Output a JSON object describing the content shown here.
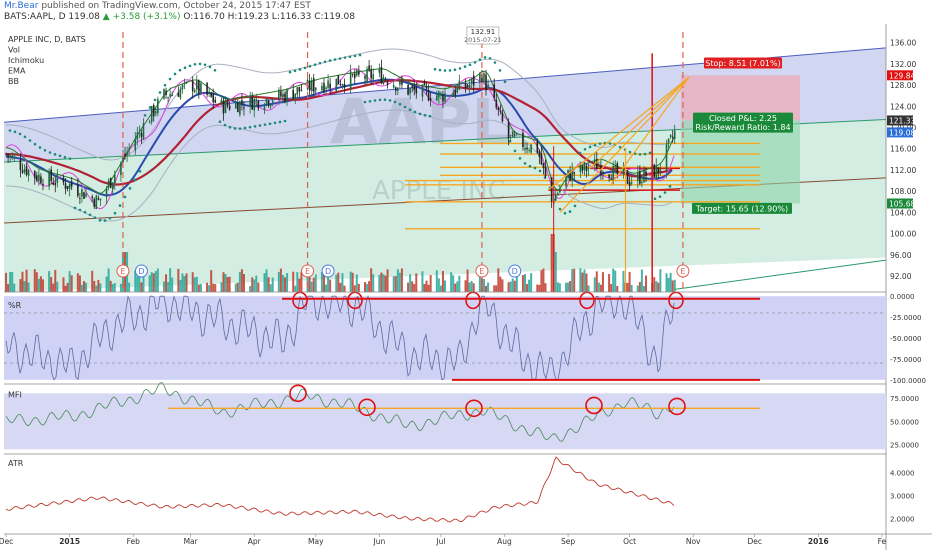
{
  "header": {
    "author": "Mr.Bear",
    "published": "published on TradingView.com, October 24, 2015 17:47 EST",
    "symbol": "BATS:AAPL, D",
    "price": "119.08",
    "change": "+3.58 (+3.1%)",
    "ohlc": "O:116.70 H:119.23 L:116.33 C:119.08"
  },
  "colors": {
    "up": "#26a69a",
    "down": "#c0392b",
    "ema": "#b22234",
    "bb": "#1010aa",
    "ichimoku_conv": "#e040e0",
    "ichimoku_cloud_up": "#c8ead4",
    "ichimoku_cloud_down": "#f7c8cf",
    "annotation": "#e01010",
    "level": "#f5a623",
    "channel": "#4a5cc0"
  },
  "chart_data": [
    {
      "type": "candlestick",
      "pane": "price",
      "legend": [
        "APPLE INC, D, BATS",
        "Vol",
        "Ichimoku",
        "EMA",
        "BB"
      ],
      "watermark": [
        "AAPL",
        "APPLE INC"
      ],
      "x_ticks": [
        "Dec",
        "2015",
        "Feb",
        "Mar",
        "Apr",
        "May",
        "Jun",
        "Jul",
        "Aug",
        "Sep",
        "Oct",
        "Nov",
        "Dec",
        "2016",
        "Fe"
      ],
      "y_ticks": [
        "136.00",
        "132.00",
        "128.00",
        "124.00",
        "120.00",
        "116.00",
        "112.00",
        "108.00",
        "104.00",
        "100.00",
        "96.00",
        "92.00"
      ],
      "ylim": [
        89,
        138
      ],
      "price_labels": [
        {
          "value": 129.84,
          "label": "129.84",
          "color": "#e01010"
        },
        {
          "value": 121.33,
          "label": "121.33",
          "color": "#333333"
        },
        {
          "value": 119.08,
          "label": "119.08",
          "color": "#2a6fd6"
        },
        {
          "value": 105.68,
          "label": "105.68",
          "color": "#1a8a3a"
        }
      ],
      "peak_label": {
        "price": "132.91",
        "date": "2015-07-21"
      },
      "earnings_markers": [
        "E",
        "D",
        "E",
        "D",
        "E",
        "D",
        "E"
      ],
      "position": {
        "stop": "Stop: 8.51 (7.01%)",
        "pnl": "Closed P&L: 2.25",
        "rr": "Risk/Reward Ratio: 1.84",
        "target": "Target: 15.65 (12.90%)",
        "entry": 121.33,
        "stop_price": 129.84,
        "target_price": 105.68
      },
      "horizontal_levels": [
        117.0,
        115.0,
        112.5,
        111.0,
        110.0,
        109.2,
        106.0,
        100.9
      ],
      "series": [
        {
          "name": "Close",
          "x": [
            "2014-12-01",
            "2014-12-15",
            "2015-01-02",
            "2015-01-15",
            "2015-02-02",
            "2015-02-16",
            "2015-03-02",
            "2015-03-16",
            "2015-04-01",
            "2015-04-15",
            "2015-05-01",
            "2015-05-15",
            "2015-06-01",
            "2015-06-15",
            "2015-07-01",
            "2015-07-15",
            "2015-07-21",
            "2015-08-03",
            "2015-08-17",
            "2015-08-24",
            "2015-09-01",
            "2015-09-15",
            "2015-10-01",
            "2015-10-15",
            "2015-10-23"
          ],
          "values": [
            115,
            111,
            109,
            106,
            118,
            126,
            128,
            124,
            125,
            126,
            128,
            129,
            130,
            127,
            126,
            128,
            130,
            118,
            116,
            106,
            111,
            113,
            110,
            112,
            119
          ]
        }
      ]
    },
    {
      "type": "line",
      "pane": "williams_r",
      "title": "%R",
      "y_ticks": [
        "0.0000",
        "-25.0000",
        "-50.0000",
        "-75.0000",
        "-100.0000"
      ],
      "ylim": [
        -105,
        5
      ],
      "series": [
        {
          "name": "%R",
          "x": [
            "2014-12-01",
            "2015-01-02",
            "2015-01-20",
            "2015-02-16",
            "2015-03-16",
            "2015-04-15",
            "2015-04-27",
            "2015-05-20",
            "2015-06-15",
            "2015-07-10",
            "2015-07-21",
            "2015-08-10",
            "2015-08-24",
            "2015-09-15",
            "2015-09-29",
            "2015-10-15",
            "2015-10-23"
          ],
          "values": [
            -60,
            -85,
            -40,
            -5,
            -30,
            -55,
            -5,
            -10,
            -70,
            -80,
            -5,
            -75,
            -95,
            -10,
            -5,
            -80,
            -3
          ]
        }
      ]
    },
    {
      "type": "line",
      "pane": "mfi",
      "title": "MFI",
      "y_ticks": [
        "75.0000",
        "50.0000",
        "25.0000"
      ],
      "ylim": [
        15,
        90
      ],
      "series": [
        {
          "name": "MFI",
          "x": [
            "2014-12-01",
            "2015-01-02",
            "2015-02-16",
            "2015-03-16",
            "2015-04-27",
            "2015-05-20",
            "2015-06-15",
            "2015-07-21",
            "2015-08-24",
            "2015-09-15",
            "2015-09-29",
            "2015-10-15",
            "2015-10-23"
          ],
          "values": [
            50,
            55,
            85,
            60,
            78,
            65,
            45,
            62,
            30,
            55,
            72,
            58,
            70
          ]
        }
      ]
    },
    {
      "type": "line",
      "pane": "atr",
      "title": "ATR",
      "y_ticks": [
        "4.0000",
        "3.0000",
        "2.0000"
      ],
      "ylim": [
        1.5,
        4.8
      ],
      "series": [
        {
          "name": "ATR",
          "x": [
            "2014-12-01",
            "2015-01-15",
            "2015-02-16",
            "2015-03-16",
            "2015-04-15",
            "2015-05-20",
            "2015-06-15",
            "2015-07-10",
            "2015-07-28",
            "2015-08-17",
            "2015-08-26",
            "2015-09-15",
            "2015-10-15",
            "2015-10-23"
          ],
          "values": [
            2.4,
            2.9,
            2.5,
            2.6,
            2.2,
            2.3,
            2.0,
            1.9,
            2.5,
            2.7,
            4.6,
            3.5,
            2.8,
            2.6
          ]
        }
      ]
    }
  ]
}
